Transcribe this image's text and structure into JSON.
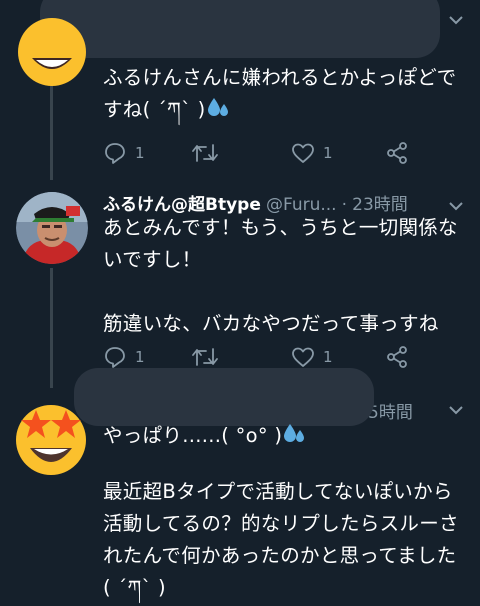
{
  "colors": {
    "background": "#15202b",
    "secondary_text": "#8899a6",
    "thread_line": "#38444d",
    "emoji_yellow": "#fbc02d",
    "drops_blue": "#5dade2"
  },
  "tweets": [
    {
      "text_line1": "ふるけんさんに嫌われるとかよっぽどで",
      "text_line2_prefix": "すね( ´ཀ` )",
      "emoji": "sweat-droplets-icon",
      "reply_count": "1",
      "like_count": "1"
    },
    {
      "name": "ふるけん@超Btype",
      "handle": "@Furu...",
      "separator": "·",
      "time": "23時間",
      "text": "あとみんです！もう、うちと一切関係な\nいですし！\n\n筋違いな、バカなやつだって事っすね",
      "reply_count": "1",
      "like_count": "1"
    },
    {
      "time_partial": "5時間",
      "text_line1_prefix": "やっぱり......( °o° )",
      "emoji": "sweat-droplets-icon",
      "text_rest": "最近超Bタイプで活動してないぽいから\n活動してるの？的なリプしたらスルーさ\nれたんで何かあったのかと思ってました\n( ´ཀ` )"
    }
  ]
}
